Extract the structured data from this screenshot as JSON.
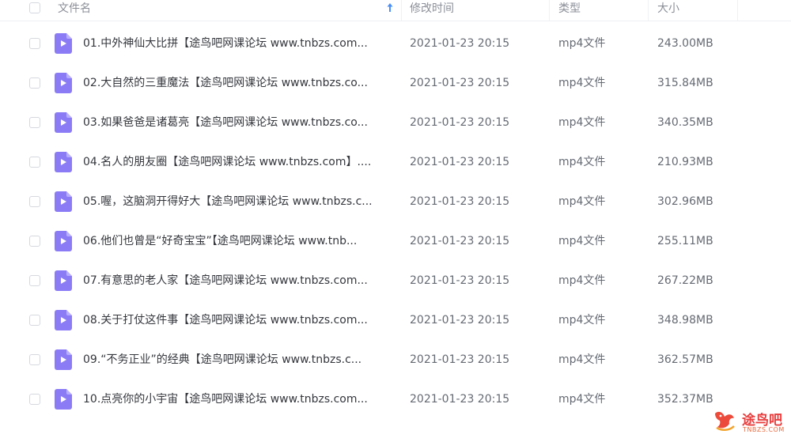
{
  "header": {
    "name_label": "文件名",
    "modified_label": "修改时间",
    "type_label": "类型",
    "size_label": "大小",
    "sort_icon": "sort-ascending-arrow-icon",
    "accent_color": "#4a8ff7"
  },
  "files": [
    {
      "name": "01.中外神仙大比拼【途鸟吧网课论坛 www.tnbzs.com...",
      "modified": "2021-01-23 20:15",
      "type": "mp4文件",
      "size": "243.00MB"
    },
    {
      "name": "02.大自然的三重魔法【途鸟吧网课论坛 www.tnbzs.co...",
      "modified": "2021-01-23 20:15",
      "type": "mp4文件",
      "size": "315.84MB"
    },
    {
      "name": "03.如果爸爸是诸葛亮【途鸟吧网课论坛 www.tnbzs.co...",
      "modified": "2021-01-23 20:15",
      "type": "mp4文件",
      "size": "340.35MB"
    },
    {
      "name": "04.名人的朋友圈【途鸟吧网课论坛 www.tnbzs.com】....",
      "modified": "2021-01-23 20:15",
      "type": "mp4文件",
      "size": "210.93MB"
    },
    {
      "name": "05.喔，这脑洞开得好大【途鸟吧网课论坛 www.tnbzs.c...",
      "modified": "2021-01-23 20:15",
      "type": "mp4文件",
      "size": "302.96MB"
    },
    {
      "name": "06.他们也曾是“好奇宝宝”【途鸟吧网课论坛 www.tnb...",
      "modified": "2021-01-23 20:15",
      "type": "mp4文件",
      "size": "255.11MB"
    },
    {
      "name": "07.有意思的老人家【途鸟吧网课论坛 www.tnbzs.com...",
      "modified": "2021-01-23 20:15",
      "type": "mp4文件",
      "size": "267.22MB"
    },
    {
      "name": "08.关于打仗这件事【途鸟吧网课论坛 www.tnbzs.com...",
      "modified": "2021-01-23 20:15",
      "type": "mp4文件",
      "size": "348.98MB"
    },
    {
      "name": "09.“不务正业”的经典【途鸟吧网课论坛 www.tnbzs.c...",
      "modified": "2021-01-23 20:15",
      "type": "mp4文件",
      "size": "362.57MB"
    },
    {
      "name": "10.点亮你的小宇宙【途鸟吧网课论坛 www.tnbzs.com...",
      "modified": "2021-01-23 20:15",
      "type": "mp4文件",
      "size": "352.37MB"
    }
  ],
  "file_icon": {
    "name": "video-file-icon",
    "color": "#8b7cf6"
  },
  "watermark": {
    "text": "途鸟吧",
    "subtext": "TNBZS.COM"
  }
}
